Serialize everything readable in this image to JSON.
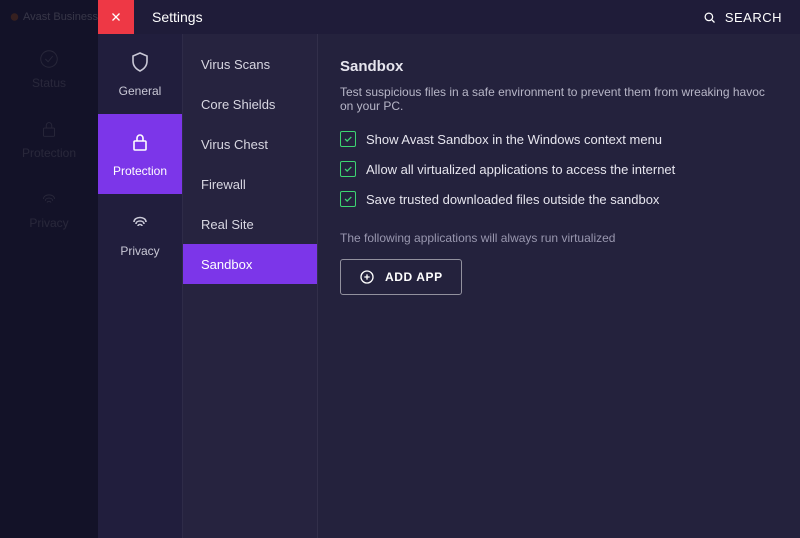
{
  "brand": {
    "name": "Avast Business"
  },
  "mainNav": {
    "items": [
      {
        "label": "Status",
        "icon": "check-circle"
      },
      {
        "label": "Protection",
        "icon": "lock"
      },
      {
        "label": "Privacy",
        "icon": "fingerprint"
      }
    ]
  },
  "settings": {
    "title": "Settings",
    "searchLabel": "SEARCH"
  },
  "categories": {
    "items": [
      {
        "label": "General",
        "icon": "shield"
      },
      {
        "label": "Protection",
        "icon": "lock",
        "active": true
      },
      {
        "label": "Privacy",
        "icon": "fingerprint"
      }
    ]
  },
  "subnav": {
    "items": [
      {
        "label": "Virus Scans"
      },
      {
        "label": "Core Shields"
      },
      {
        "label": "Virus Chest"
      },
      {
        "label": "Firewall"
      },
      {
        "label": "Real Site"
      },
      {
        "label": "Sandbox",
        "active": true
      }
    ]
  },
  "content": {
    "heading": "Sandbox",
    "description": "Test suspicious files in a safe environment to prevent them from wreaking havoc on your PC.",
    "checkboxes": [
      {
        "label": "Show Avast Sandbox in the Windows context menu",
        "checked": true
      },
      {
        "label": "Allow all virtualized applications to access the internet",
        "checked": true
      },
      {
        "label": "Save trusted downloaded files outside the sandbox",
        "checked": true
      }
    ],
    "virtualizedNote": "The following applications will always run virtualized",
    "addAppLabel": "ADD APP"
  }
}
